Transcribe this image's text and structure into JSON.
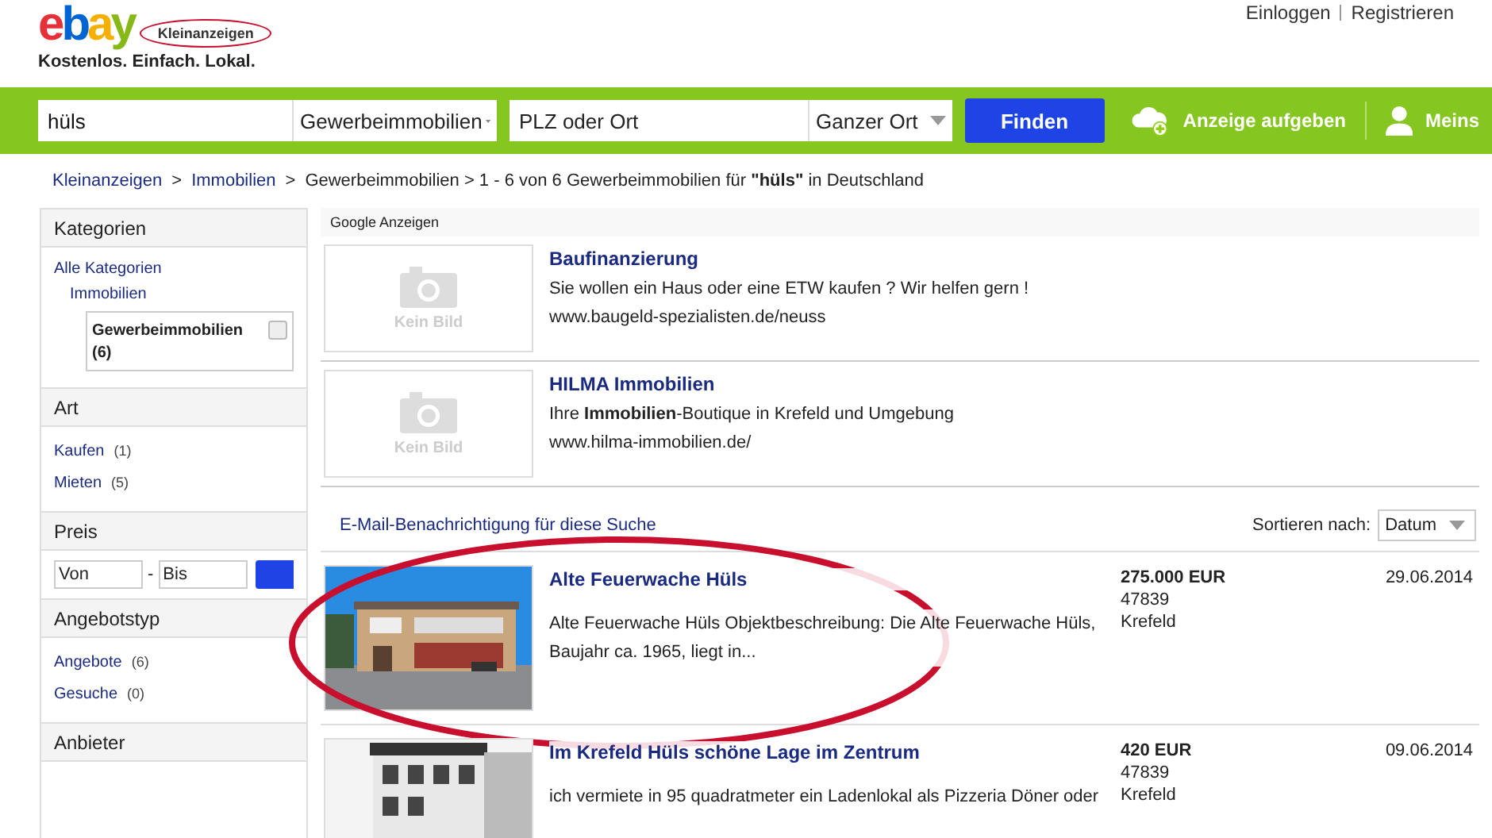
{
  "header": {
    "logo": "ebay",
    "badge": "Kleinanzeigen",
    "tagline": "Kostenlos. Einfach. Lokal.",
    "links": [
      "Einloggen",
      "Registrieren"
    ]
  },
  "search": {
    "query": "hüls",
    "category": "Gewerbeimmobilien",
    "location_placeholder": "PLZ oder Ort",
    "radius": "Ganzer Ort",
    "button": "Finden",
    "post": "Anzeige aufgeben",
    "account": "Meins"
  },
  "breadcrumb": {
    "links": [
      "Kleinanzeigen",
      "Immobilien"
    ],
    "separator": ">",
    "current": "Gewerbeimmobilien > 1 - 6 von 6 Gewerbeimmobilien für **\"hüls\"** in Deutschland"
  },
  "sidebar": [
    {
      "kind": "tree",
      "title": "Kategorien",
      "root": "Alle Kategorien",
      "child": "Immobilien",
      "selected": {
        "label": "Gewerbeimmobilien",
        "count": "(6)",
        "checked": false
      }
    },
    {
      "kind": "links",
      "title": "Art",
      "items": [
        {
          "label": "Kaufen",
          "count": "(1)"
        },
        {
          "label": "Mieten",
          "count": "(5)"
        }
      ]
    },
    {
      "kind": "price",
      "title": "Preis",
      "from_placeholder": "Von",
      "separator": "-",
      "to_placeholder": "Bis"
    },
    {
      "kind": "links",
      "title": "Angebotstyp",
      "items": [
        {
          "label": "Angebote",
          "count": "(6)"
        },
        {
          "label": "Gesuche",
          "count": "(0)"
        }
      ]
    },
    {
      "kind": "header",
      "title": "Anbieter"
    }
  ],
  "ads": {
    "title": "Google Anzeigen",
    "items": [
      {
        "image_text": "Kein Bild",
        "title": "Baufinanzierung",
        "text": "Sie wollen ein Haus oder eine ETW kaufen ? Wir helfen gern !",
        "url": "www.baugeld-spezialisten.de/neuss"
      },
      {
        "image_text": "Kein Bild",
        "title": "HILMA Immobilien",
        "text": "Ihre **Immobilien**-Boutique in Krefeld und Umgebung",
        "url": "www.hilma-immobilien.de/"
      }
    ]
  },
  "results": {
    "email_link": "E-Mail-Benachrichtigung für diese Suche",
    "sort_label": "Sortieren nach:",
    "sort_value": "Datum",
    "items": [
      {
        "kind": "picture",
        "highlighted": true,
        "title": "Alte Feuerwache Hüls",
        "text": "Alte Feuerwache Hüls Objektbeschreibung: Die Alte Feuerwache Hüls, Baujahr ca. 1965, liegt in...",
        "price": "275.000 EUR",
        "zip": "47839",
        "city": "Krefeld",
        "date": "29.06.2014"
      },
      {
        "kind": "picture",
        "highlighted": false,
        "title": "Im Krefeld Hüls schöne Lage im Zentrum",
        "text": "ich vermiete in 95 quadratmeter ein Ladenlokal als Pizzeria Döner oder",
        "price": "420 EUR",
        "zip": "47839",
        "city": "Krefeld",
        "date": "09.06.2014"
      }
    ]
  }
}
